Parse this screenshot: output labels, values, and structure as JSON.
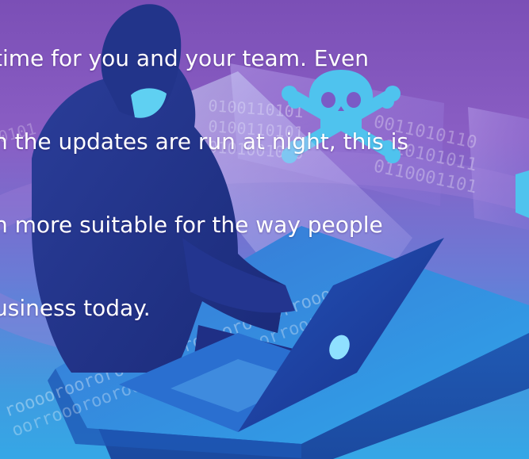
{
  "caption": {
    "lines": [
      "time for you and your team. Even",
      "n the updates are run at night, this is",
      "n more suitable for the way people",
      "usiness today."
    ]
  },
  "binary_strings": {
    "screen_1": "0100110101",
    "screen_2": "0100110101",
    "screen_3": "0101001010",
    "right_1": "0011010110",
    "right_2": "0110101011",
    "right_3": "0110001101",
    "left_1": "0101",
    "desk_1": "rooooroororooorrorrorooroooorrooooroooor",
    "desk_2": "oorrooorooroooroooorororoorroororroooorr"
  },
  "colors": {
    "accent_cyan": "#5fd0f2",
    "skull": "#4fc3ee",
    "desk_top": "#2f8fd8",
    "laptop": "#1e3fa0"
  },
  "icons": [
    "skull-crossbones-icon",
    "hooded-hacker-figure",
    "laptop-icon"
  ]
}
